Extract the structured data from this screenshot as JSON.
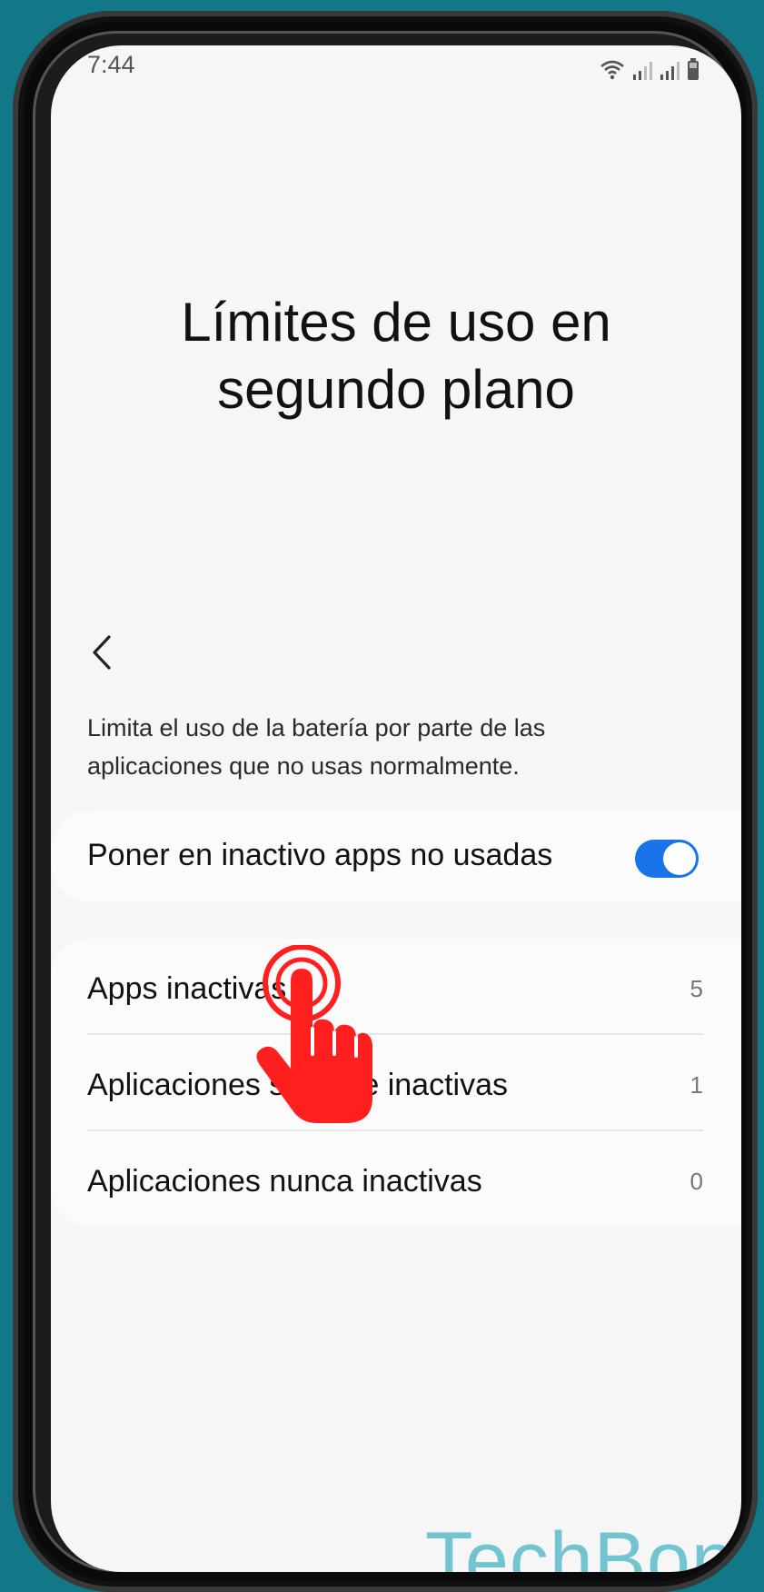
{
  "status_bar": {
    "time": "7:44",
    "icons": [
      "wifi-icon",
      "signal-icon",
      "signal-icon",
      "battery-icon"
    ]
  },
  "page": {
    "title_line1": "Límites de uso en",
    "title_line2": "segundo plano",
    "back_icon": "chevron-left-icon",
    "description_line1": "Limita el uso de la batería por parte de las",
    "description_line2": "aplicaciones que no usas normalmente."
  },
  "toggle": {
    "label": "Poner en inactivo apps no usadas",
    "enabled": true,
    "accent_color": "#1a73e8"
  },
  "list": {
    "items": [
      {
        "label": "Apps inactivas",
        "count": "5"
      },
      {
        "label": "Aplicaciones siempre inactivas",
        "count": "1"
      },
      {
        "label": "Aplicaciones nunca inactivas",
        "count": "0"
      }
    ]
  },
  "overlay": {
    "pointer_icon": "tap-hand-icon",
    "pointer_color": "#ff1f1f",
    "watermark": "TechBone"
  },
  "colors": {
    "background": "#127887",
    "screen": "#f6f6f6",
    "watermark": "#72c4d0"
  }
}
